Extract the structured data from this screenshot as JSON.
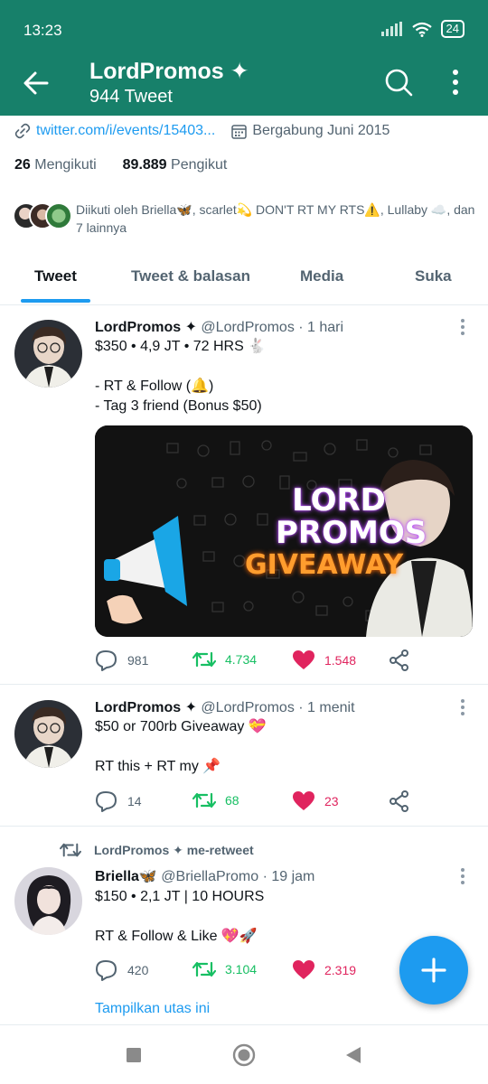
{
  "status_bar": {
    "time": "13:23",
    "battery": "24"
  },
  "header": {
    "title": "LordPromos ✦",
    "subtitle": "944 Tweet"
  },
  "profile": {
    "link": "twitter.com/i/events/15403...",
    "joined": "Bergabung Juni 2015",
    "following_count": "26",
    "following_label": "Mengikuti",
    "followers_count": "89.889",
    "followers_label": "Pengikut",
    "followed_by": "Diikuti oleh Briella🦋, scarlet💫 DON'T RT MY RTS⚠️, Lullaby ☁️, dan 7 lainnya"
  },
  "tabs": [
    {
      "label": "Tweet"
    },
    {
      "label": "Tweet & balasan"
    },
    {
      "label": "Media"
    },
    {
      "label": "Suka"
    }
  ],
  "tweets": [
    {
      "name": "LordPromos ✦",
      "handle": "@LordPromos",
      "time": "· 1 hari",
      "text": "$350 • 4,9 JT • 72 HRS 🐇\n\n- RT & Follow (🔔)\n- Tag 3 friend (Bonus $50)",
      "media": {
        "line1": "LORD",
        "line2": "PROMOS",
        "line3": "GIVEAWAY"
      },
      "replies": "981",
      "retweets": "4.734",
      "likes": "1.548"
    },
    {
      "name": "LordPromos ✦",
      "handle": "@LordPromos",
      "time": "· 1 menit",
      "text": "$50 or 700rb Giveaway 💝\n\nRT this + RT my 📌",
      "replies": "14",
      "retweets": "68",
      "likes": "23"
    },
    {
      "retweeted_by": "LordPromos ✦ me-retweet",
      "name": "Briella🦋",
      "handle": "@BriellaPromo",
      "time": "· 19 jam",
      "text": "$150 • 2,1 JT | 10  HOURS\n\nRT & Follow & Like 💖🚀",
      "replies": "420",
      "retweets": "3.104",
      "likes": "2.319",
      "show_thread": "Tampilkan utas ini"
    }
  ],
  "colors": {
    "header_bg": "#17806a",
    "accent_blue": "#1d9bf0",
    "retweet_green": "#17bf63",
    "like_pink": "#e0245e"
  }
}
